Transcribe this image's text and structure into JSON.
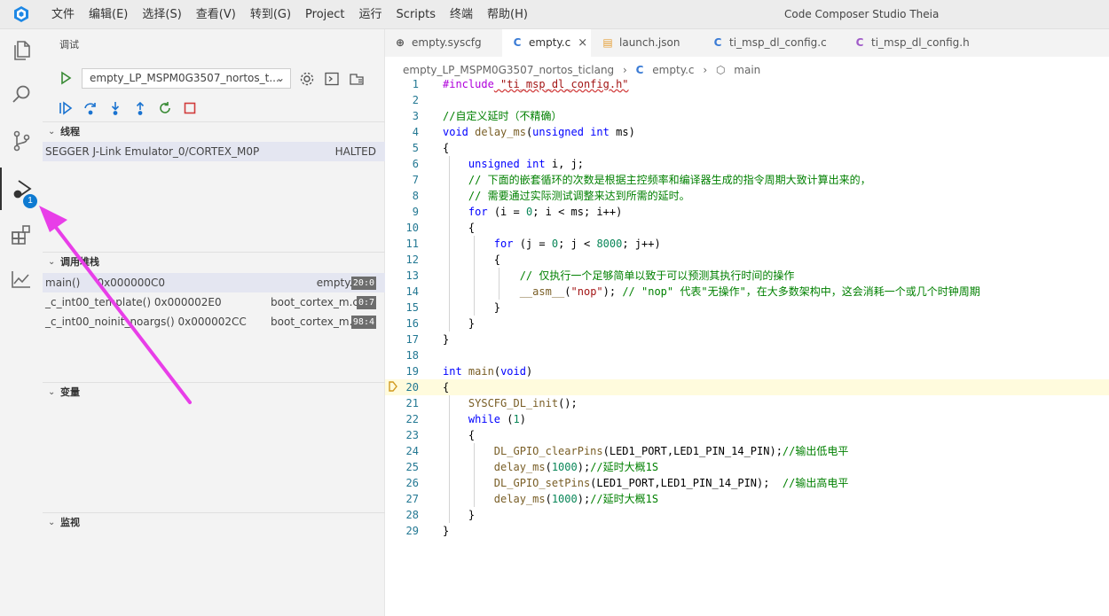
{
  "titlebar": {
    "menu": [
      "文件",
      "编辑(E)",
      "选择(S)",
      "查看(V)",
      "转到(G)",
      "Project",
      "运行",
      "Scripts",
      "终端",
      "帮助(H)"
    ],
    "title": "Code Composer Studio Theia"
  },
  "activity": {
    "items": [
      "explorer-icon",
      "search-icon",
      "source-control-icon",
      "run-debug-icon",
      "extensions-icon",
      "chart-icon"
    ],
    "debug_badge": "1"
  },
  "sidebar": {
    "title": "调试",
    "launch_config": "empty_LP_MSPM0G3507_nortos_t...",
    "threads": {
      "header": "线程",
      "items": [
        {
          "name": "SEGGER J-Link Emulator_0/CORTEX_M0P",
          "state": "HALTED"
        }
      ]
    },
    "callstack": {
      "header": "调用堆栈",
      "items": [
        {
          "func": "main()",
          "addr": "0x000000C0",
          "file": "empty.c",
          "line": "20:0"
        },
        {
          "func": "_c_int00_template() 0x000002E0",
          "addr": "",
          "file": "boot_cortex_m.c",
          "line": "0:7"
        },
        {
          "func": "_c_int00_noinit_noargs() 0x000002CC",
          "addr": "",
          "file": "boot_cortex_m.c",
          "line": "98:4"
        }
      ]
    },
    "variables": {
      "header": "变量"
    },
    "watch": {
      "header": "监视"
    }
  },
  "tabs": [
    {
      "label": "empty.syscfg",
      "icon": "globe-icon",
      "active": false
    },
    {
      "label": "empty.c",
      "icon": "c-file-icon",
      "active": true
    },
    {
      "label": "launch.json",
      "icon": "json-file-icon",
      "active": false
    },
    {
      "label": "ti_msp_dl_config.c",
      "icon": "c-file-icon",
      "active": false
    },
    {
      "label": "ti_msp_dl_config.h",
      "icon": "c-header-icon",
      "active": false
    }
  ],
  "breadcrumb": {
    "project": "empty_LP_MSPM0G3507_nortos_ticlang",
    "file": "empty.c",
    "symbol": "main"
  },
  "code": {
    "current_line": 20,
    "lines": [
      "#include \"ti_msp_dl_config.h\"",
      "",
      "//自定义延时（不精确）",
      "void delay_ms(unsigned int ms)",
      "{",
      "    unsigned int i, j;",
      "    // 下面的嵌套循环的次数是根据主控频率和编译器生成的指令周期大致计算出来的，",
      "    // 需要通过实际测试调整来达到所需的延时。",
      "    for (i = 0; i < ms; i++)",
      "    {",
      "        for (j = 0; j < 8000; j++)",
      "        {",
      "            // 仅执行一个足够简单以致于可以预测其执行时间的操作",
      "            __asm__(\"nop\"); // \"nop\" 代表\"无操作\"，在大多数架构中，这会消耗一个或几个时钟周期",
      "        }",
      "    }",
      "}",
      "",
      "int main(void)",
      "{",
      "    SYSCFG_DL_init();",
      "    while (1)",
      "    {",
      "        DL_GPIO_clearPins(LED1_PORT,LED1_PIN_14_PIN);//输出低电平",
      "        delay_ms(1000);//延时大概1S",
      "        DL_GPIO_setPins(LED1_PORT,LED1_PIN_14_PIN);  //输出高电平",
      "        delay_ms(1000);//延时大概1S",
      "    }",
      "}"
    ]
  },
  "colors": {
    "accent": "#0e7ad1",
    "annotation_arrow": "#e83ee8",
    "current_line_bg": "#fffbdd"
  }
}
